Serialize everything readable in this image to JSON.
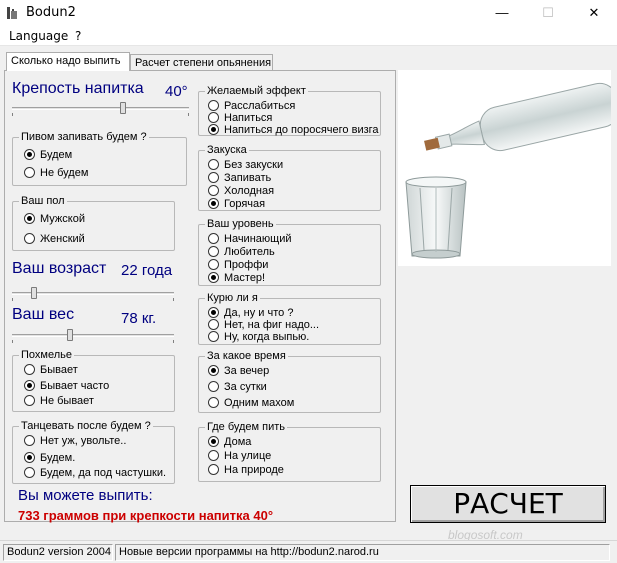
{
  "window": {
    "title": "Bodun2",
    "minimize": "—",
    "maximize": "☐",
    "close": "✕"
  },
  "menu": [
    "Language",
    "?"
  ],
  "tabs": [
    "Сколько надо выпить",
    "Расчет степени опьянения"
  ],
  "strength": {
    "label": "Крепость напитка",
    "value": "40°",
    "level_fraction": 0.63
  },
  "age": {
    "label": "Ваш возраст",
    "value": "22 года",
    "level_fraction": 0.12
  },
  "weight": {
    "label": "Ваш вес",
    "value": "78 кг.",
    "level_fraction": 0.35
  },
  "groups": {
    "beer": {
      "title": "Пивом запивать будем ?",
      "options": [
        "Будем",
        "Не будем"
      ],
      "selected": 0
    },
    "sex": {
      "title": "Ваш пол",
      "options": [
        "Мужской",
        "Женский"
      ],
      "selected": 0
    },
    "hangover": {
      "title": "Похмелье",
      "options": [
        "Бывает",
        "Бывает часто",
        "Не бывает"
      ],
      "selected": 1
    },
    "dance": {
      "title": "Танцевать после будем ?",
      "options": [
        "Нет уж, увольте..",
        "Будем.",
        "Будем, да под частушки."
      ],
      "selected": 1
    },
    "effect": {
      "title": "Желаемый эффект",
      "options": [
        "Расслабиться",
        "Напиться",
        "Напиться до поросячего визга"
      ],
      "selected": 2
    },
    "snack": {
      "title": "Закуска",
      "options": [
        "Без закуски",
        "Запивать",
        "Холодная",
        "Горячая"
      ],
      "selected": 3
    },
    "level": {
      "title": "Ваш уровень",
      "options": [
        "Начинающий",
        "Любитель",
        "Проффи",
        "Мастер!"
      ],
      "selected": 3
    },
    "smoke": {
      "title": "Курю ли я",
      "options": [
        "Да, ну и что ?",
        "Нет, на фиг надо...",
        "Ну, когда выпью."
      ],
      "selected": 0
    },
    "time": {
      "title": "За какое время",
      "options": [
        "За вечер",
        "За сутки",
        "Одним махом"
      ],
      "selected": 0
    },
    "place": {
      "title": "Где будем пить",
      "options": [
        "Дома",
        "На улице",
        "На природе"
      ],
      "selected": 0
    }
  },
  "result": {
    "label": "Вы можете выпить:",
    "value": "733 граммов при крепкости напитка 40°"
  },
  "calc_button": "РАСЧЕТ",
  "watermark": "blogosoft.com",
  "status": {
    "version": "Bodun2 version 2004",
    "message": "Новые версии программы на http://bodun2.narod.ru"
  }
}
